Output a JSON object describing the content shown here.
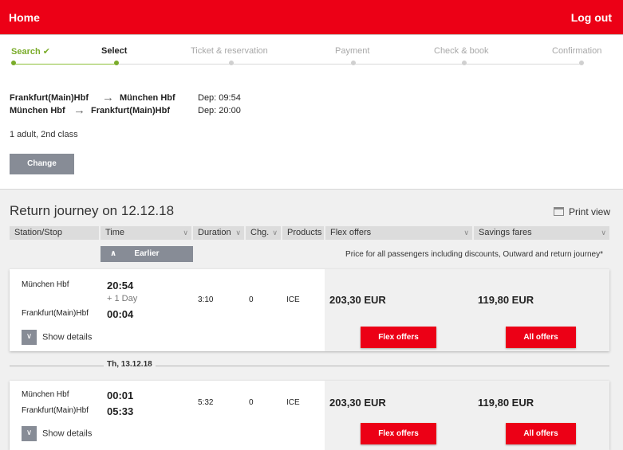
{
  "header": {
    "home_label": "Home",
    "logout_label": "Log out"
  },
  "steps": [
    {
      "label": "Search",
      "state": "done"
    },
    {
      "label": "Select",
      "state": "active"
    },
    {
      "label": "Ticket & reservation",
      "state": "todo"
    },
    {
      "label": "Payment",
      "state": "todo"
    },
    {
      "label": "Check & book",
      "state": "todo"
    },
    {
      "label": "Confirmation",
      "state": "todo"
    }
  ],
  "summary": {
    "outward": {
      "from": "Frankfurt(Main)Hbf",
      "to": "München Hbf",
      "dep": "Dep: 09:54"
    },
    "return": {
      "from": "München Hbf",
      "to": "Frankfurt(Main)Hbf",
      "dep": "Dep: 20:00"
    },
    "passengers": "1 adult, 2nd class",
    "change_label": "Change"
  },
  "results": {
    "title": "Return journey on 12.12.18",
    "print_label": "Print view",
    "columns": {
      "station": "Station/Stop",
      "time": "Time",
      "duration": "Duration",
      "changes": "Chg.",
      "products": "Products",
      "flex": "Flex offers",
      "savings": "Savings fares"
    },
    "earlier_label": "Earlier",
    "price_note": "Price for all passengers including discounts, Outward and return journey*",
    "date_separator": "Th, 13.12.18",
    "connections": [
      {
        "from": "München Hbf",
        "to": "Frankfurt(Main)Hbf",
        "dep_time": "20:54",
        "plus_day": "+ 1 Day",
        "arr_time": "00:04",
        "duration": "3:10",
        "changes": "0",
        "product": "ICE",
        "flex_price": "203,30 EUR",
        "savings_price": "119,80 EUR",
        "details_label": "Show details",
        "flex_button": "Flex offers",
        "savings_button": "All offers"
      },
      {
        "from": "München Hbf",
        "to": "Frankfurt(Main)Hbf",
        "dep_time": "00:01",
        "arr_time": "05:33",
        "duration": "5:32",
        "changes": "0",
        "product": "ICE",
        "flex_price": "203,30 EUR",
        "savings_price": "119,80 EUR",
        "details_label": "Show details",
        "flex_button": "Flex offers",
        "savings_button": "All offers"
      }
    ]
  },
  "colors": {
    "brand_red": "#ec0016",
    "progress_green": "#7aac2a",
    "button_grey": "#878c96"
  }
}
